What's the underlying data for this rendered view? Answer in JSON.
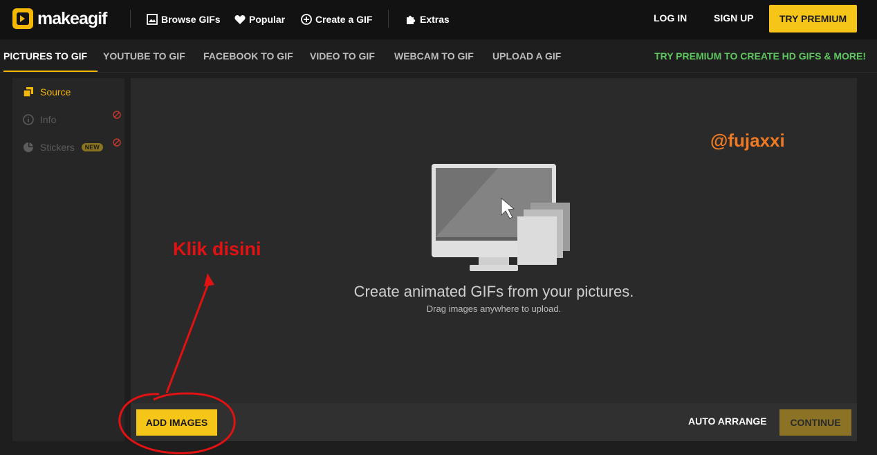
{
  "header": {
    "logo_text": "makeagif",
    "nav": [
      {
        "label": "Browse GIFs",
        "icon": "image-icon"
      },
      {
        "label": "Popular",
        "icon": "heart-icon"
      },
      {
        "label": "Create a GIF",
        "icon": "plus-circle-icon"
      },
      {
        "label": "Extras",
        "icon": "puzzle-icon"
      }
    ],
    "login": "LOG IN",
    "signup": "SIGN UP",
    "premium": "TRY PREMIUM"
  },
  "subnav": {
    "tabs": [
      {
        "label": "PICTURES TO GIF",
        "active": true
      },
      {
        "label": "YOUTUBE TO GIF",
        "active": false
      },
      {
        "label": "FACEBOOK TO GIF",
        "active": false
      },
      {
        "label": "VIDEO TO GIF",
        "active": false
      },
      {
        "label": "WEBCAM TO GIF",
        "active": false
      },
      {
        "label": "UPLOAD A GIF",
        "active": false
      }
    ],
    "promo": "TRY PREMIUM TO CREATE HD GIFS & MORE!"
  },
  "sidebar": {
    "items": [
      {
        "label": "Source",
        "icon": "copy-icon",
        "active": true
      },
      {
        "label": "Info",
        "icon": "info-icon",
        "active": false,
        "blocked": true
      },
      {
        "label": "Stickers",
        "icon": "sticker-icon",
        "active": false,
        "blocked": true,
        "badge": "NEW"
      }
    ]
  },
  "main": {
    "title": "Create animated GIFs from your pictures.",
    "subtitle": "Drag images anywhere to upload."
  },
  "actions": {
    "add_images": "ADD IMAGES",
    "auto_arrange": "AUTO ARRANGE",
    "continue": "CONTINUE"
  },
  "annotations": {
    "watermark": "@fujaxxi",
    "klik": "Klik disini"
  },
  "colors": {
    "accent": "#f5c518",
    "promo": "#5fc75f",
    "annotation_red": "#e21212",
    "watermark_orange": "#f07a24"
  }
}
